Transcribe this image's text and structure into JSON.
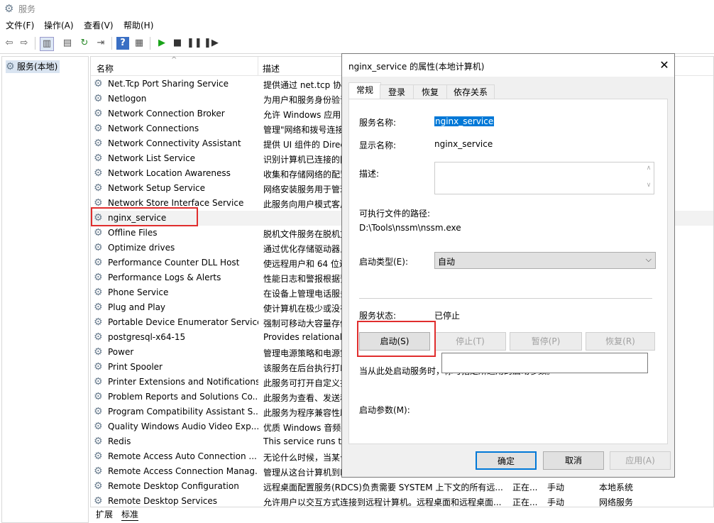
{
  "window": {
    "title": "服务"
  },
  "menu": [
    "文件(F)",
    "操作(A)",
    "查看(V)",
    "帮助(H)"
  ],
  "tree": {
    "root_label": "服务(本地)"
  },
  "columns": {
    "name": "名称",
    "description": "描述"
  },
  "services": [
    {
      "name": "Net.Tcp Port Sharing Service",
      "desc": "提供通过 net.tcp 协议",
      "status": "",
      "startup": "",
      "logon": ""
    },
    {
      "name": "Netlogon",
      "desc": "为用户和服务身份验证",
      "status": "",
      "startup": "",
      "logon": ""
    },
    {
      "name": "Network Connection Broker",
      "desc": "允许 Windows 应用",
      "status": "",
      "startup": "",
      "logon": ""
    },
    {
      "name": "Network Connections",
      "desc": "管理\"网络和拨号连接",
      "status": "",
      "startup": "",
      "logon": ""
    },
    {
      "name": "Network Connectivity Assistant",
      "desc": "提供 UI 组件的 Direc",
      "status": "",
      "startup": "",
      "logon": ""
    },
    {
      "name": "Network List Service",
      "desc": "识别计算机已连接的网",
      "status": "",
      "startup": "",
      "logon": ""
    },
    {
      "name": "Network Location Awareness",
      "desc": "收集和存储网络的配置",
      "status": "",
      "startup": "",
      "logon": ""
    },
    {
      "name": "Network Setup Service",
      "desc": "网络安装服务用于管理",
      "status": "",
      "startup": "",
      "logon": ""
    },
    {
      "name": "Network Store Interface Service",
      "desc": "此服务向用户模式客户",
      "status": "",
      "startup": "",
      "logon": ""
    },
    {
      "name": "nginx_service",
      "desc": "",
      "status": "",
      "startup": "",
      "logon": ""
    },
    {
      "name": "Offline Files",
      "desc": "脱机文件服务在脱机文",
      "status": "",
      "startup": "",
      "logon": ""
    },
    {
      "name": "Optimize drives",
      "desc": "通过优化存储驱动器上",
      "status": "",
      "startup": "",
      "logon": ""
    },
    {
      "name": "Performance Counter DLL Host",
      "desc": "使远程用户和 64 位进",
      "status": "",
      "startup": "",
      "logon": ""
    },
    {
      "name": "Performance Logs & Alerts",
      "desc": "性能日志和警报根据预",
      "status": "",
      "startup": "",
      "logon": ""
    },
    {
      "name": "Phone Service",
      "desc": "在设备上管理电话服务",
      "status": "",
      "startup": "",
      "logon": ""
    },
    {
      "name": "Plug and Play",
      "desc": "使计算机在极少或没有",
      "status": "",
      "startup": "",
      "logon": ""
    },
    {
      "name": "Portable Device Enumerator Service",
      "desc": "强制可移动大容量存储",
      "status": "",
      "startup": "",
      "logon": ""
    },
    {
      "name": "postgresql-x64-15",
      "desc": "Provides relational",
      "status": "",
      "startup": "",
      "logon": ""
    },
    {
      "name": "Power",
      "desc": "管理电源策略和电源策",
      "status": "",
      "startup": "",
      "logon": ""
    },
    {
      "name": "Print Spooler",
      "desc": "该服务在后台执行打印",
      "status": "",
      "startup": "",
      "logon": ""
    },
    {
      "name": "Printer Extensions and Notifications",
      "desc": "此服务可打开自定义打",
      "status": "",
      "startup": "",
      "logon": ""
    },
    {
      "name": "Problem Reports and Solutions Co...",
      "desc": "此服务为查看、发送和",
      "status": "",
      "startup": "",
      "logon": ""
    },
    {
      "name": "Program Compatibility Assistant S...",
      "desc": "此服务为程序兼容性助",
      "status": "",
      "startup": "",
      "logon": ""
    },
    {
      "name": "Quality Windows Audio Video Exp...",
      "desc": "优质 Windows 音频视",
      "status": "",
      "startup": "",
      "logon": ""
    },
    {
      "name": "Redis",
      "desc": "This service runs the",
      "status": "",
      "startup": "",
      "logon": ""
    },
    {
      "name": "Remote Access Auto Connection ...",
      "desc": "无论什么时候，当某个",
      "status": "",
      "startup": "",
      "logon": ""
    },
    {
      "name": "Remote Access Connection Manag...",
      "desc": "管理从这台计算机到Inte",
      "status": "",
      "startup": "",
      "logon": ""
    },
    {
      "name": "Remote Desktop Configuration",
      "desc": "远程桌面配置服务(RDCS)负责需要 SYSTEM 上下文的所有远...",
      "status": "正在...",
      "startup": "手动",
      "logon": "本地系统"
    },
    {
      "name": "Remote Desktop Services",
      "desc": "允许用户以交互方式连接到远程计算机。远程桌面和远程桌面...",
      "status": "正在...",
      "startup": "手动",
      "logon": "网络服务"
    }
  ],
  "bottom_tabs": [
    "扩展",
    "标准"
  ],
  "dialog": {
    "title": "nginx_service 的属性(本地计算机)",
    "tabs": [
      "常规",
      "登录",
      "恢复",
      "依存关系"
    ],
    "service_name_label": "服务名称:",
    "service_name": "nginx_service",
    "display_name_label": "显示名称:",
    "display_name": "nginx_service",
    "description_label": "描述:",
    "exe_path_label": "可执行文件的路径:",
    "exe_path": "D:\\Tools\\nssm\\nssm.exe",
    "startup_type_label": "启动类型(E):",
    "startup_type": "自动",
    "status_label": "服务状态:",
    "status_value": "已停止",
    "btn_start": "启动(S)",
    "btn_stop": "停止(T)",
    "btn_pause": "暂停(P)",
    "btn_resume": "恢复(R)",
    "hint": "当从此处启动服务时，你可指定所适用的启动参数。",
    "params_label": "启动参数(M):",
    "btn_ok": "确定",
    "btn_cancel": "取消",
    "btn_apply": "应用(A)"
  },
  "colors": {
    "highlight": "#e02d2d",
    "selection": "#0078d7"
  }
}
